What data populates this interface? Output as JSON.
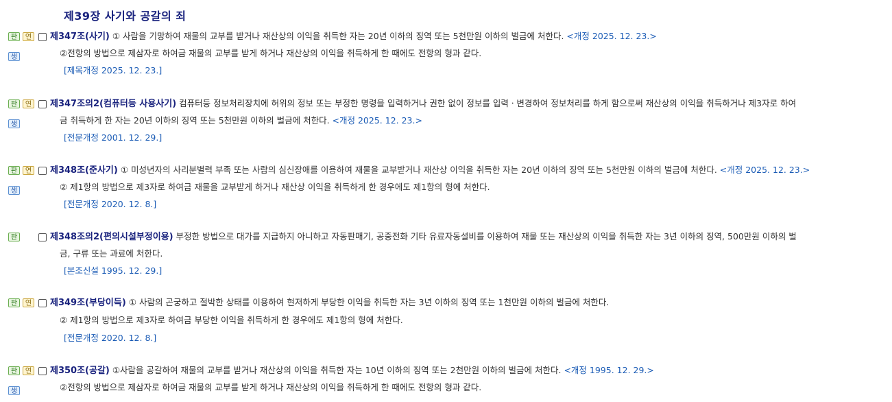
{
  "chapter_title": "제39장 사기와 공갈의 죄",
  "badges": {
    "pan": "판",
    "yeon": "연",
    "saeng": "생"
  },
  "articles": [
    {
      "title": "제347조(사기)",
      "line1": "① 사람을 기망하여 재물의 교부를 받거나 재산상의 이익을 취득한 자는 20년 이하의 징역 또는 5천만원 이하의 벌금에 처한다.",
      "line1_amend": "<개정 2025. 12. 23.>",
      "line2": "②전항의 방법으로 제삼자로 하여금 재물의 교부를 받게 하거나 재산상의 이익을 취득하게 한 때에도 전항의 형과 같다.",
      "line2_amend": "",
      "history": "[제목개정 2025. 12. 23.]"
    },
    {
      "title": "제347조의2(컴퓨터등 사용사기)",
      "line1": "컴퓨터등 정보처리장치에 허위의 정보 또는 부정한 명령을 입력하거나 권한 없이 정보를 입력ㆍ변경하여 정보처리를 하게 함으로써 재산상의 이익을 취득하거나 제3자로 하여",
      "line1_amend": "",
      "line2": "금 취득하게 한 자는 20년 이하의 징역 또는 5천만원 이하의 벌금에 처한다.",
      "line2_amend": "<개정 2025. 12. 23.>",
      "history": "[전문개정 2001. 12. 29.]"
    },
    {
      "title": "제348조(준사기)",
      "line1": "① 미성년자의 사리분별력 부족 또는 사람의 심신장애를 이용하여 재물을 교부받거나 재산상 이익을 취득한 자는 20년 이하의 징역 또는 5천만원 이하의 벌금에 처한다.",
      "line1_amend": "<개정 2025. 12. 23.>",
      "line2": "② 제1항의 방법으로 제3자로 하여금 재물을 교부받게 하거나 재산상 이익을 취득하게 한 경우에도 제1항의 형에 처한다.",
      "line2_amend": "",
      "history": "[전문개정 2020. 12. 8.]"
    },
    {
      "title": "제348조의2(편의시설부정이용)",
      "line1": "부정한 방법으로 대가를 지급하지 아니하고 자동판매기, 공중전화 기타 유료자동설비를 이용하여 재물 또는 재산상의 이익을 취득한 자는 3년 이하의 징역, 500만원 이하의 벌",
      "line1_amend": "",
      "line2": "금, 구류 또는 과료에 처한다.",
      "line2_amend": "",
      "history": "[본조신설 1995. 12. 29.]"
    },
    {
      "title": "제349조(부당이득)",
      "line1": "① 사람의 곤궁하고 절박한 상태를 이용하여 현저하게 부당한 이익을 취득한 자는 3년 이하의 징역 또는 1천만원 이하의 벌금에 처한다.",
      "line1_amend": "",
      "line2": "② 제1항의 방법으로 제3자로 하여금 부당한 이익을 취득하게 한 경우에도 제1항의 형에 처한다.",
      "line2_amend": "",
      "history": "[전문개정 2020. 12. 8.]"
    },
    {
      "title": "제350조(공갈)",
      "line1": "①사람을 공갈하여 재물의 교부를 받거나 재산상의 이익을 취득한 자는 10년 이하의 징역 또는 2천만원 이하의 벌금에 처한다.",
      "line1_amend": "<개정 1995. 12. 29.>",
      "line2": "②전항의 방법으로 제삼자로 하여금 재물의 교부를 받게 하거나 재산상의 이익을 취득하게 한 때에도 전항의 형과 같다.",
      "line2_amend": "",
      "history": ""
    }
  ]
}
